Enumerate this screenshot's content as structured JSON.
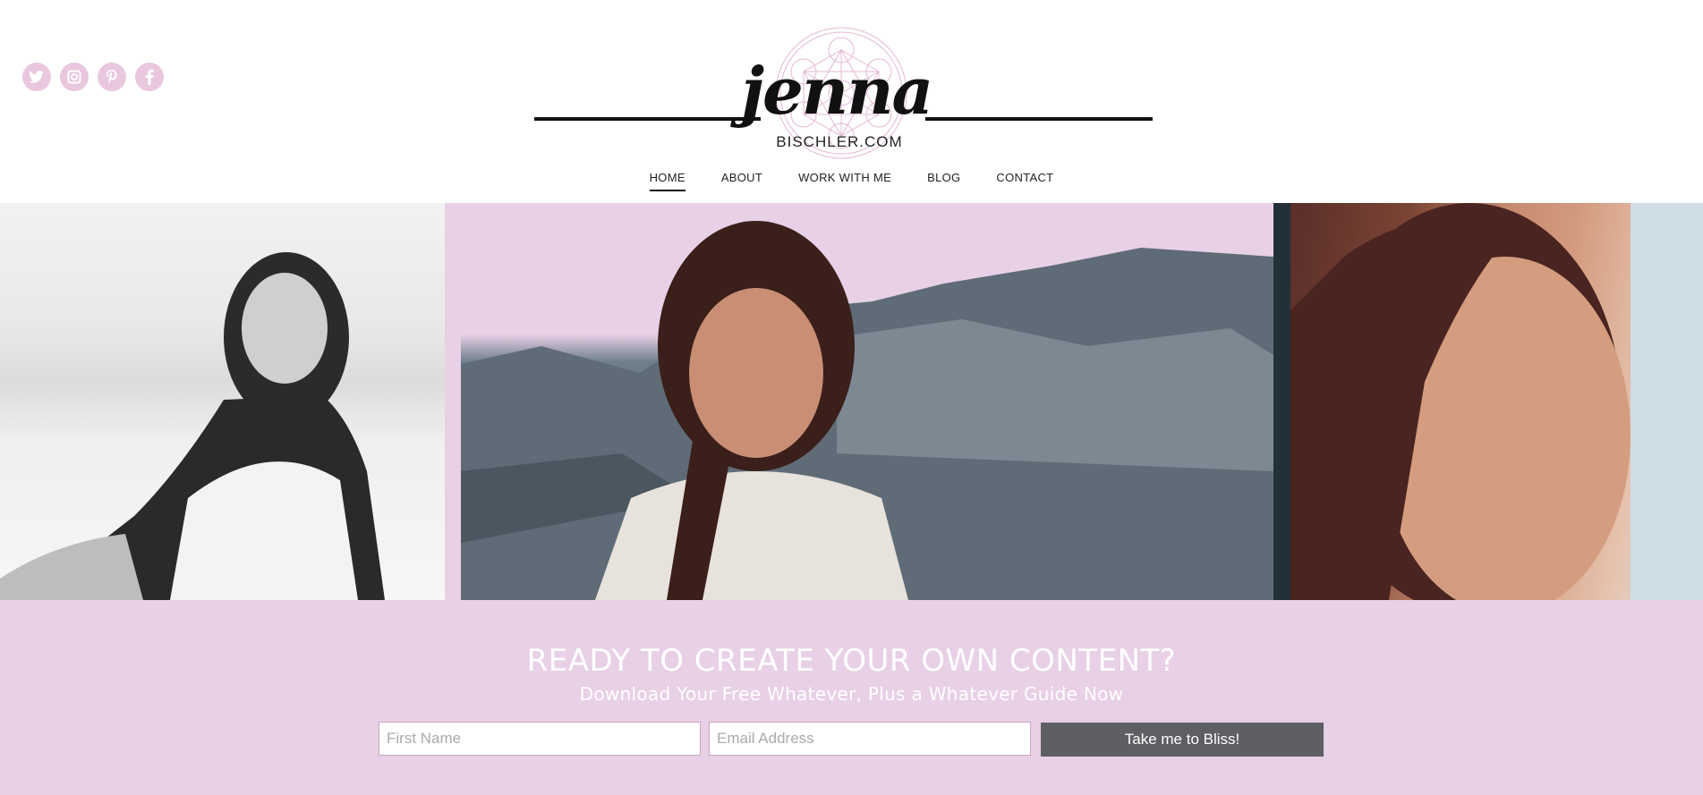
{
  "social": {
    "icons": [
      "twitter-icon",
      "instagram-icon",
      "pinterest-icon",
      "facebook-icon"
    ],
    "color": "#e8c7df"
  },
  "logo": {
    "script": "jenna",
    "domain": "BISCHLER.COM"
  },
  "nav": {
    "items": [
      {
        "label": "HOME",
        "active": true
      },
      {
        "label": "ABOUT",
        "active": false
      },
      {
        "label": "WORK WITH ME",
        "active": false
      },
      {
        "label": "BLOG",
        "active": false
      },
      {
        "label": "CONTACT",
        "active": false
      }
    ]
  },
  "cta": {
    "heading": "READY TO CREATE YOUR OWN CONTENT?",
    "subheading": "Download Your Free Whatever, Plus a Whatever Guide Now",
    "first_name_placeholder": "First Name",
    "email_placeholder": "Email Address",
    "button_label": "Take me to Bliss!",
    "background": "#e8d0e6",
    "button_color": "#5e5f63"
  }
}
